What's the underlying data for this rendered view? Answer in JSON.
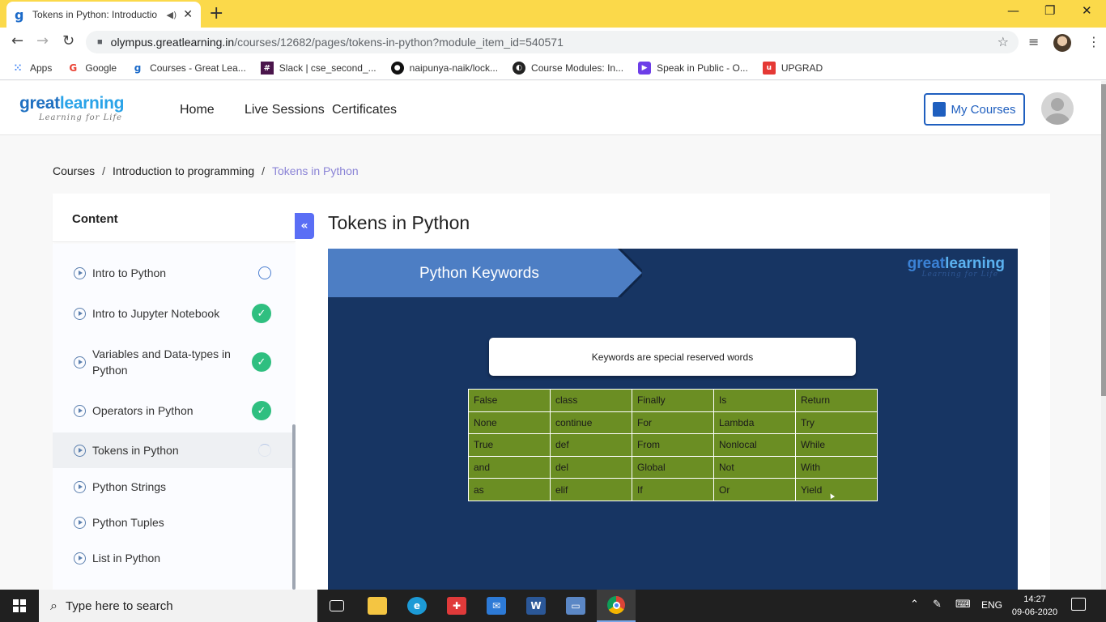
{
  "browser": {
    "tab_title": "Tokens in Python: Introductio",
    "url_domain": "olympus.greatlearning.in",
    "url_path": "/courses/12682/pages/tokens-in-python?module_item_id=540571",
    "bookmarks": [
      {
        "label": "Apps",
        "icon": "apps-grid-icon",
        "color": "#4285f4"
      },
      {
        "label": "Google",
        "icon": "google-icon",
        "color": "#ea4335"
      },
      {
        "label": "Courses - Great Lea...",
        "icon": "greatlearning-icon",
        "color": "#1b6ac9"
      },
      {
        "label": "Slack | cse_second_...",
        "icon": "slack-icon",
        "color": "#4a154b"
      },
      {
        "label": "naipunya-naik/lock...",
        "icon": "github-icon",
        "color": "#111111"
      },
      {
        "label": "Course Modules: In...",
        "icon": "globe-icon",
        "color": "#222222"
      },
      {
        "label": "Speak in Public - O...",
        "icon": "speak-icon",
        "color": "#6d3ee8"
      },
      {
        "label": "UPGRAD",
        "icon": "upgrad-icon",
        "color": "#e53935"
      }
    ]
  },
  "site": {
    "logo_main": "great",
    "logo_accent": "learning",
    "logo_tagline": "Learning for Life",
    "nav": [
      "Home",
      "Live Sessions",
      "Certificates"
    ],
    "my_courses": "My Courses"
  },
  "breadcrumb": {
    "items": [
      "Courses",
      "Introduction to programming"
    ],
    "current": "Tokens in Python"
  },
  "sidebar": {
    "title": "Content",
    "items": [
      {
        "label": "Intro to Python",
        "status": "not-started"
      },
      {
        "label": "Intro to Jupyter Notebook",
        "status": "completed"
      },
      {
        "label": "Variables and Data-types in Python",
        "status": "completed"
      },
      {
        "label": "Operators in Python",
        "status": "completed"
      },
      {
        "label": "Tokens in Python",
        "status": "in-progress"
      },
      {
        "label": "Python Strings",
        "status": "none"
      },
      {
        "label": "Python Tuples",
        "status": "none"
      },
      {
        "label": "List in Python",
        "status": "none"
      }
    ]
  },
  "lesson": {
    "title": "Tokens in Python",
    "slide": {
      "banner": "Python Keywords",
      "logo_main": "great",
      "logo_accent": "learning",
      "logo_tagline": "Learning for Life",
      "callout": "Keywords are special reserved words",
      "keywords": [
        [
          "False",
          "class",
          "Finally",
          "Is",
          "Return"
        ],
        [
          "None",
          "continue",
          "For",
          "Lambda",
          "Try"
        ],
        [
          "True",
          "def",
          "From",
          "Nonlocal",
          "While"
        ],
        [
          "and",
          "del",
          "Global",
          "Not",
          "With"
        ],
        [
          "as",
          "elif",
          "If",
          "Or",
          "Yield"
        ]
      ]
    }
  },
  "taskbar": {
    "search_placeholder": "Type here to search",
    "language": "ENG",
    "time": "14:27",
    "date": "09-06-2020"
  },
  "colors": {
    "brand_blue": "#1f70c1",
    "completed_green": "#2fbf80",
    "slide_bg": "#173563",
    "table_green": "#6b8e23",
    "collapse_button": "#5a6ef5"
  }
}
